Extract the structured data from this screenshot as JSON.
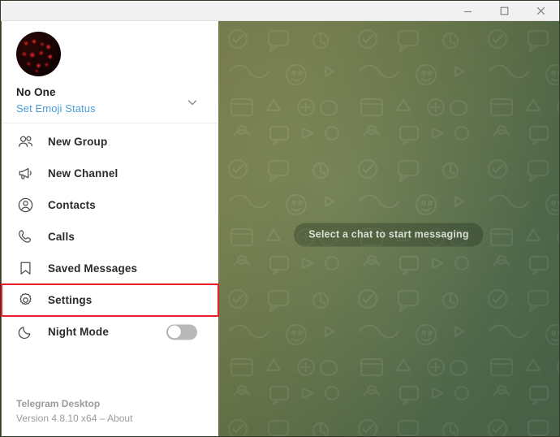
{
  "window": {
    "title_bar": {
      "minimize_label": "Minimize",
      "maximize_label": "Maximize",
      "close_label": "Close",
      "minimize_icon": "minimize-icon",
      "maximize_icon": "maximize-icon",
      "close_icon": "close-icon"
    }
  },
  "sidebar": {
    "profile": {
      "avatar_icon": "user-avatar",
      "name": "No One",
      "status_link": "Set Emoji Status",
      "chevron_icon": "chevron-down-icon"
    },
    "menu": [
      {
        "label": "New Group",
        "icon": "users-icon"
      },
      {
        "label": "New Channel",
        "icon": "megaphone-icon"
      },
      {
        "label": "Contacts",
        "icon": "contact-circle-icon"
      },
      {
        "label": "Calls",
        "icon": "phone-icon"
      },
      {
        "label": "Saved Messages",
        "icon": "bookmark-icon"
      },
      {
        "label": "Settings",
        "icon": "gear-icon"
      },
      {
        "label": "Night Mode",
        "icon": "moon-icon"
      }
    ],
    "night_mode": {
      "state": "off"
    },
    "footer": {
      "app_name": "Telegram Desktop",
      "version_line": "Version 4.8.10 x64 – About"
    }
  },
  "chat": {
    "placeholder": "Select a chat to start messaging"
  },
  "colors": {
    "highlight_box": "#ee1c25",
    "link_blue": "#4a9fd8",
    "sidebar_bg": "#ffffff",
    "titlebar_bg": "#f1f1f1",
    "chat_bg_start": "#7e8351",
    "chat_bg_end": "#4f6a4e",
    "toggle_off_track": "#b9b9b9"
  }
}
